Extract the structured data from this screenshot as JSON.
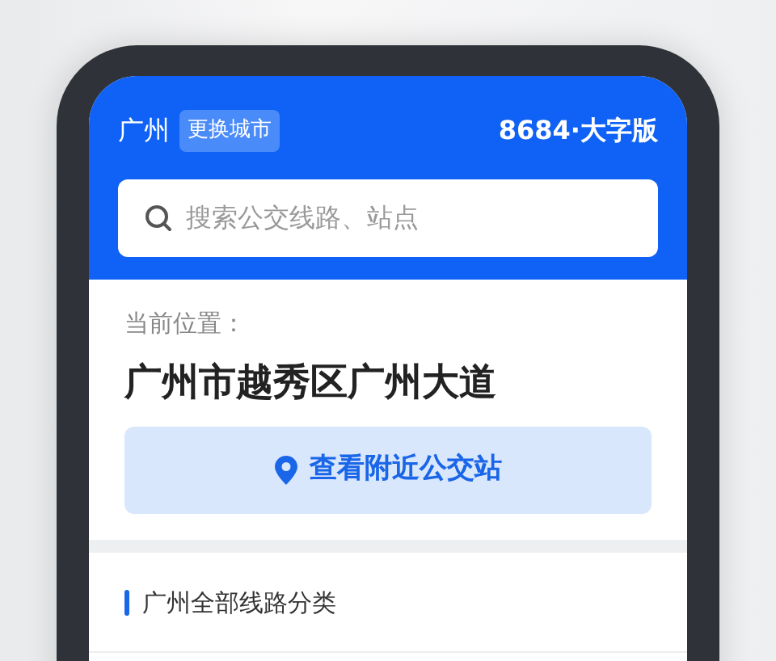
{
  "header": {
    "city": "广州",
    "change_city": "更换城市",
    "brand": "8684·大字版"
  },
  "search": {
    "placeholder": "搜索公交线路、站点"
  },
  "location": {
    "label": "当前位置：",
    "address": "广州市越秀区广州大道"
  },
  "nearby_button": "查看附近公交站",
  "section": {
    "title": "广州全部线路分类"
  }
}
